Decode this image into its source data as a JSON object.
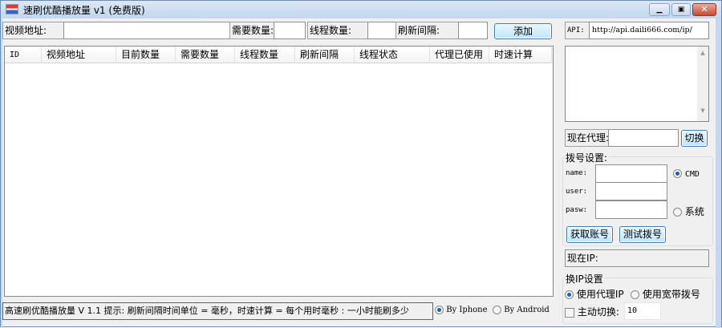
{
  "window": {
    "title": "速刷优酷播放量 v1 (免费版)"
  },
  "top": {
    "url_label": "视频地址:",
    "url_value": "",
    "need_label": "需要数量:",
    "need_value": "",
    "thread_label": "线程数量:",
    "thread_value": "",
    "interval_label": "刷新间隔:",
    "interval_value": "",
    "add_button": "添加"
  },
  "list": {
    "columns": [
      "ID",
      "视频地址",
      "目前数量",
      "需要数量",
      "线程数量",
      "刷新间隔",
      "线程状态",
      "代理已使用",
      "时速计算"
    ]
  },
  "api": {
    "label": "API:",
    "value": "http://api.daili666.com/ip/"
  },
  "proxy": {
    "label": "现在代理:",
    "value": "",
    "switch_button": "切换"
  },
  "dial": {
    "title": "拨号设置:",
    "name_label": "name:",
    "user_label": "user:",
    "pasw_label": "pasw:",
    "cmd_option": "CMD",
    "system_option": "系统",
    "get_account_button": "获取账号",
    "test_dial_button": "测试拨号"
  },
  "current_ip": {
    "label": "现在IP:"
  },
  "ip_switch": {
    "title": "换IP设置",
    "use_proxy": "使用代理IP",
    "use_broadband": "使用宽带拨号",
    "auto_switch_label": "主动切换:",
    "auto_switch_value": "10"
  },
  "status": {
    "text": "高速刷优酷播放量 V 1.1  提示: 刷新间隔时间单位 = 毫秒，时速计算 = 每个用时毫秒 : 一小时能刷多少",
    "by_iphone": "By Iphone",
    "by_android": "By Android"
  }
}
